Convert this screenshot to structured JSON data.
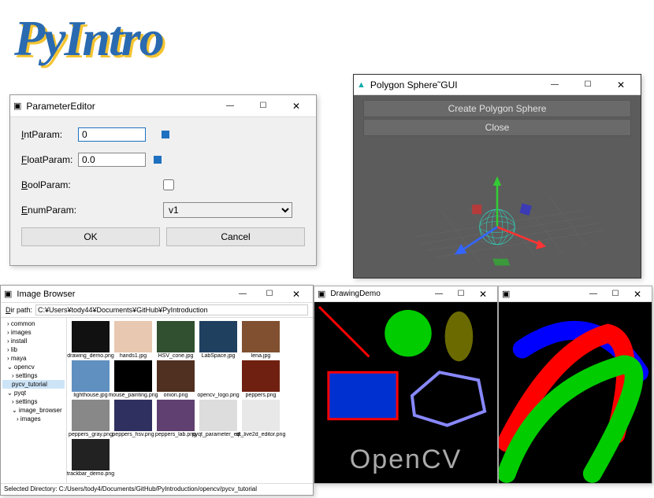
{
  "logo": "PyIntro",
  "param_editor": {
    "title": "ParameterEditor",
    "int_label": "IntParam:",
    "int_value": "0",
    "float_label": "FloatParam:",
    "float_value": "0.0",
    "bool_label": "BoolParam:",
    "enum_label": "EnumParam:",
    "enum_value": "v1",
    "ok": "OK",
    "cancel": "Cancel"
  },
  "polygon_gui": {
    "title": "Polygon Sphere˜GUI",
    "create_btn": "Create Polygon Sphere",
    "close_btn": "Close"
  },
  "image_browser": {
    "title": "Image Browser",
    "dir_label": "Dir path:",
    "dir_value": "C:¥Users¥tody44¥Documents¥GitHub¥PyIntroduction",
    "status": "Selected Directory: C:/Users/tody4/Documents/GitHub/PyIntroduction/opencv/pycv_tutorial",
    "tree": [
      "common",
      "images",
      "install",
      "lib",
      "maya",
      "opencv",
      "settings",
      "pycv_tutorial",
      "pyqt",
      "settings",
      "image_browser",
      "images"
    ],
    "thumbs": [
      "drawing_demo.png",
      "hands1.jpg",
      "HSV_cone.jpg",
      "LabSpace.jpg",
      "lena.jpg",
      "lighthouse.jpg",
      "mouse_painting.png",
      "onion.png",
      "opencv_logo.png",
      "peppers.png",
      "peppers_gray.png",
      "peppers_hsv.png",
      "peppers_lab.png",
      "pyqt_parameter_ed...",
      "qt_live2d_editor.png",
      "trackbar_demo.png"
    ]
  },
  "drawing_demo": {
    "title": "DrawingDemo",
    "text": "OpenCV"
  },
  "painting": {
    "title": ""
  }
}
